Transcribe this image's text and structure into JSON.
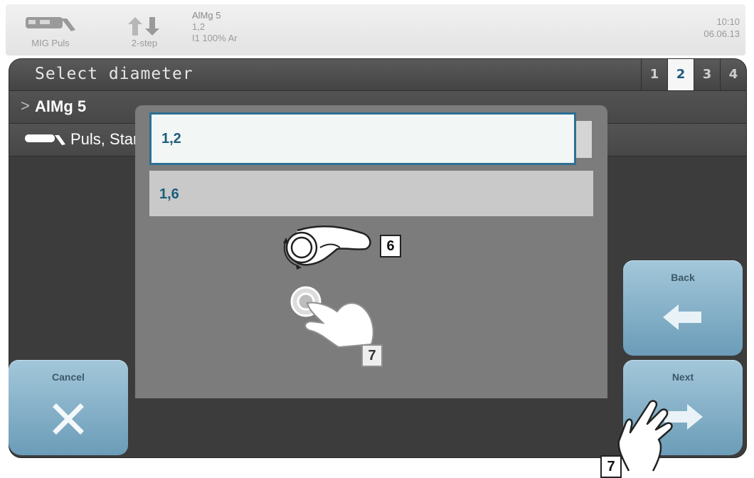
{
  "status_bar": {
    "mode_label": "MIG Puls",
    "mode_icon": "torch-icon",
    "step_label": "2-step",
    "step_icon": "up-down-arrows-icon",
    "info_material": "AlMg 5",
    "info_diameter": "1,2",
    "info_gas": "I1 100% Ar",
    "time": "10:10",
    "date": "06.06.13"
  },
  "header": {
    "title": "Select diameter",
    "steps": [
      "1",
      "2",
      "3",
      "4"
    ],
    "active_step": "2"
  },
  "rows": {
    "material_prefix": ">",
    "material": "AlMg 5",
    "process_icon": "torch-icon",
    "process": "Puls, Standard"
  },
  "list": {
    "items": [
      "1,2",
      "1,6"
    ],
    "selected": "1,2"
  },
  "buttons": {
    "cancel": "Cancel",
    "back": "Back",
    "next": "Next"
  },
  "callouts": {
    "knob": "6",
    "touch": "7",
    "next_touch": "7"
  },
  "colors": {
    "accent": "#1d5d7c",
    "button": "#8fb8cf",
    "panel": "#3c3c3c"
  }
}
